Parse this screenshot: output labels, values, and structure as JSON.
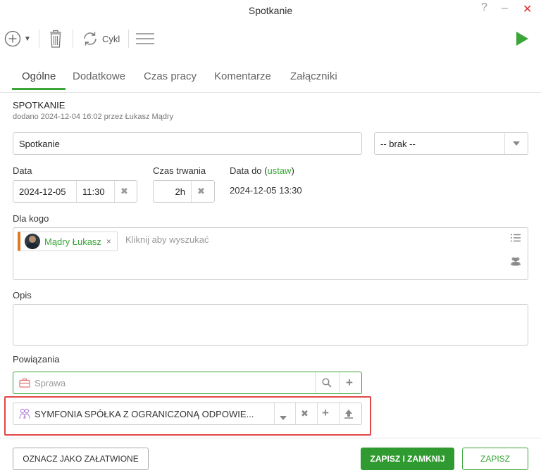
{
  "window": {
    "title": "Spotkanie",
    "help": "?",
    "minimize": "–",
    "close": "✕"
  },
  "toolbar": {
    "add_caret": "▼",
    "cykl_label": "Cykl"
  },
  "tabs": [
    {
      "label": "Ogólne",
      "active": true
    },
    {
      "label": "Dodatkowe"
    },
    {
      "label": "Czas pracy"
    },
    {
      "label": "Komentarze"
    },
    {
      "label": "Załączniki"
    }
  ],
  "section": {
    "title": "SPOTKANIE",
    "added": "dodano 2024-12-04 16:02  przez Łukasz Mądry"
  },
  "subject": {
    "value": "Spotkanie"
  },
  "category_select": {
    "value": "-- brak --"
  },
  "date": {
    "label": "Data",
    "date": "2024-12-05",
    "time": "11:30",
    "clear": "✖"
  },
  "duration": {
    "label": "Czas trwania",
    "value": "2h",
    "clear": "✖"
  },
  "date_to": {
    "label": "Data do (",
    "link": "ustaw",
    "label_end": ")",
    "value": "2024-12-05 13:30"
  },
  "for_whom": {
    "label": "Dla kogo",
    "chip_name": "Mądry Łukasz",
    "chip_remove": "×",
    "placeholder": "Kliknij aby wyszukać"
  },
  "description": {
    "label": "Opis",
    "value": ""
  },
  "relations": {
    "label": "Powiązania",
    "case_placeholder": "Sprawa",
    "company_value": "SYMFONIA SPÓŁKA Z OGRANICZONĄ ODPOWIE...",
    "plus": "+",
    "clear": "✖"
  },
  "footer": {
    "mark_done": "OZNACZ JAKO ZAŁATWIONE",
    "save_close": "ZAPISZ I ZAMKNIJ",
    "save": "ZAPISZ"
  },
  "colors": {
    "accent": "#3aa63a",
    "highlight": "#e04848",
    "chip_bar": "#e07820",
    "close": "#e03030"
  },
  "icons": [
    "add-circle-icon",
    "trash-icon",
    "refresh-icon",
    "hamburger-menu-icon",
    "play-icon",
    "briefcase-icon",
    "search-icon",
    "plus-icon",
    "company-icon",
    "upload-icon",
    "list-icon",
    "group-icon"
  ]
}
